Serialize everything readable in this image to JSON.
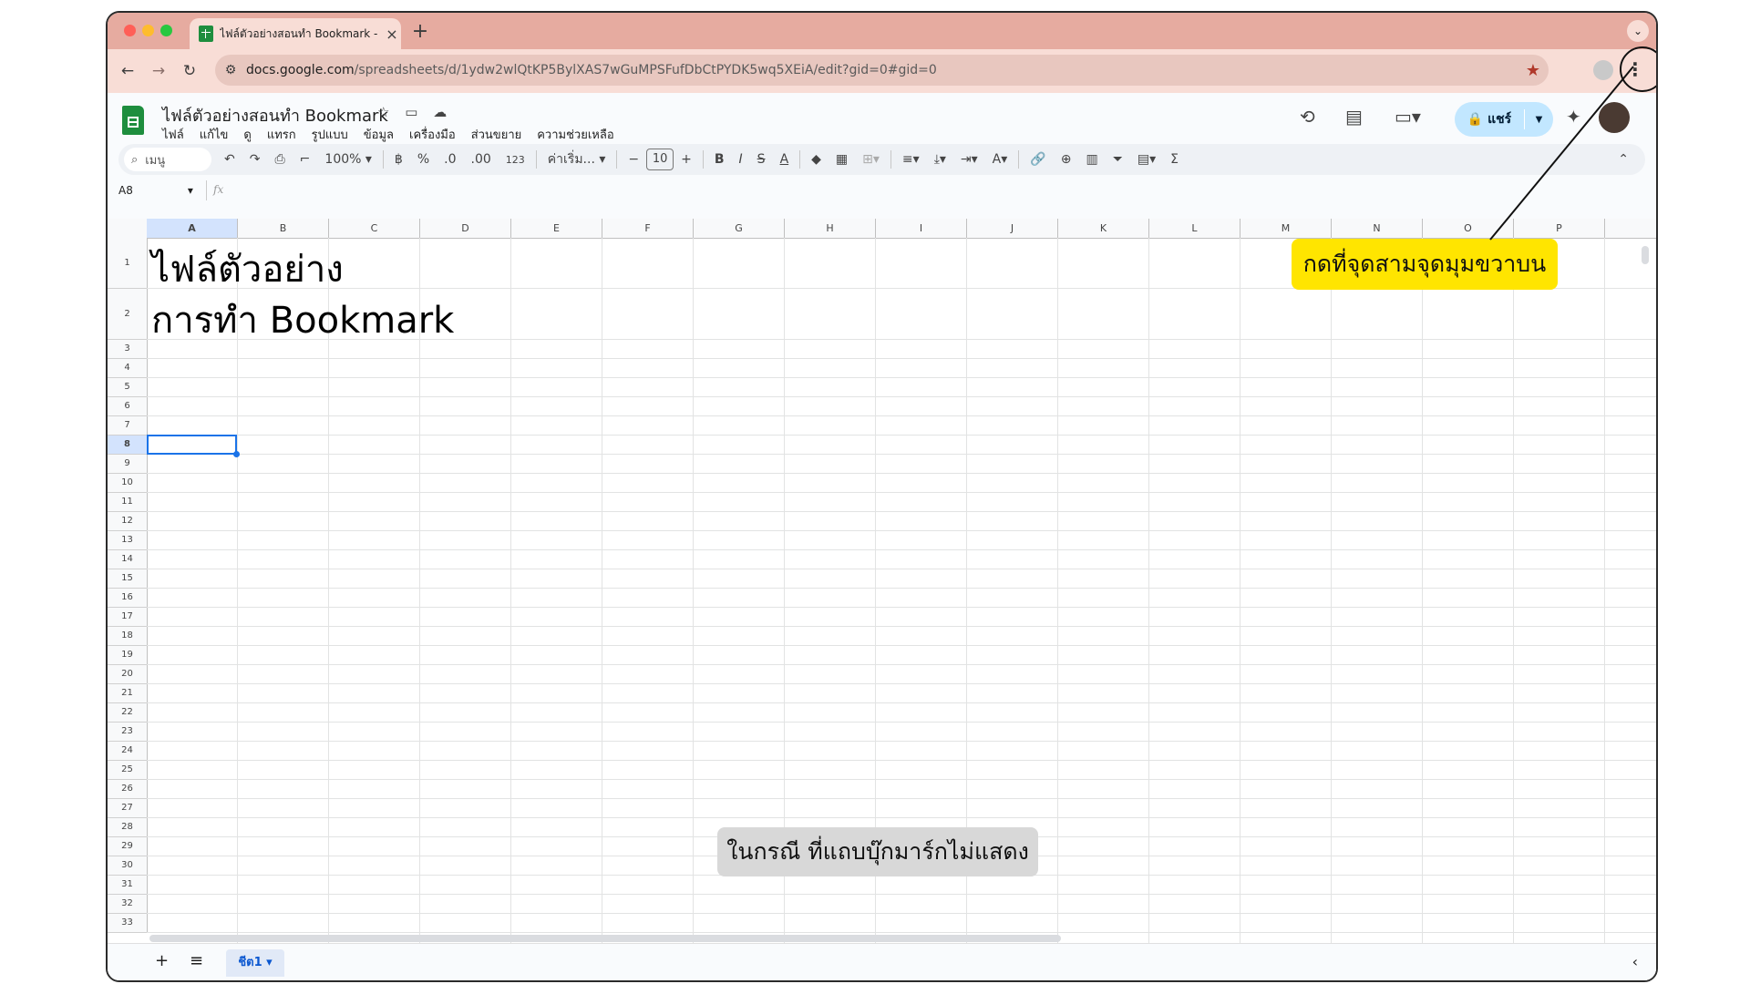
{
  "browser": {
    "tab_title": "ไฟล์ตัวอย่างสอนทำ Bookmark -",
    "tab_close": "×",
    "new_tab": "+",
    "url_host": "docs.google.com",
    "url_path": "/spreadsheets/d/1ydw2wlQtKP5BylXAS7wGuMPSFufDbCtPYDK5wq5XEiA/edit?gid=0#gid=0",
    "menu_glyph": "⋮"
  },
  "doc": {
    "title": "ไฟล์ตัวอย่างสอนทำ Bookmark",
    "menus": [
      "ไฟล์",
      "แก้ไข",
      "ดู",
      "แทรก",
      "รูปแบบ",
      "ข้อมูล",
      "เครื่องมือ",
      "ส่วนขยาย",
      "ความช่วยเหลือ"
    ],
    "share_label": "แชร์"
  },
  "toolbar": {
    "search_label": "เมนู",
    "zoom": "100%",
    "currency": "฿",
    "percent": "%",
    "dec_minus": ".0",
    "dec_plus": ".00",
    "num_format": "123",
    "font_name": "ค่าเริ่ม...",
    "font_size": "10",
    "bold": "B",
    "italic": "I",
    "strike": "S",
    "text_color": "A",
    "sum": "Σ"
  },
  "formula_bar": {
    "name_box": "A8",
    "fx": "fx"
  },
  "sheet": {
    "columns": [
      "A",
      "B",
      "C",
      "D",
      "E",
      "F",
      "G",
      "H",
      "I",
      "J",
      "K",
      "L",
      "M",
      "N",
      "O",
      "P"
    ],
    "rows": [
      "1",
      "2",
      "3",
      "4",
      "5",
      "6",
      "7",
      "8",
      "9",
      "10",
      "11",
      "12",
      "13",
      "14",
      "15",
      "16",
      "17",
      "18",
      "19",
      "20",
      "21",
      "22",
      "23",
      "24",
      "25",
      "26",
      "27",
      "28",
      "29",
      "30",
      "31",
      "32",
      "33"
    ],
    "a1": "ไฟล์ตัวอย่าง",
    "a2": "การทำ Bookmark",
    "selected_cell": "A8",
    "sheet_tab": "ชีต1"
  },
  "annotations": {
    "callout": "กดที่จุดสามจุดมุมขวาบน",
    "note": "ในกรณี ที่แถบบุ๊กมาร์กไม่แสดง"
  },
  "colors": {
    "chrome_bg": "#e6aba0",
    "callout_bg": "#ffe500",
    "sheets_green": "#1e8e3e",
    "selection_blue": "#1a73e8"
  }
}
